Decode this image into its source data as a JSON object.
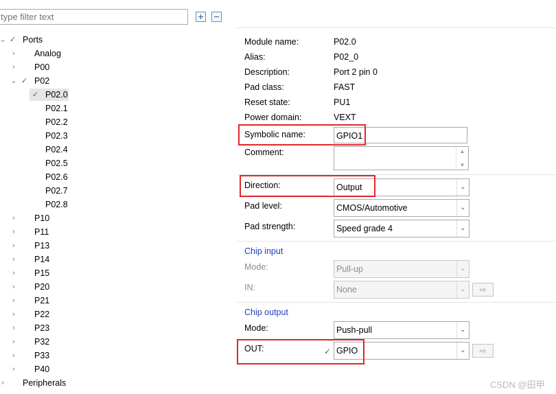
{
  "filter": {
    "placeholder": "type filter text"
  },
  "toolbar": {
    "expand_all": "expand-all-icon",
    "collapse_all": "collapse-all-icon"
  },
  "tree": {
    "root": "Ports",
    "items": [
      "Analog",
      "P00",
      "P02",
      "P02.0",
      "P02.1",
      "P02.2",
      "P02.3",
      "P02.4",
      "P02.5",
      "P02.6",
      "P02.7",
      "P02.8",
      "P10",
      "P11",
      "P13",
      "P14",
      "P15",
      "P20",
      "P21",
      "P22",
      "P23",
      "P32",
      "P33",
      "P40"
    ],
    "bottom": "Peripherals"
  },
  "props": {
    "module_name_label": "Module name:",
    "module_name": "P02.0",
    "alias_label": "Alias:",
    "alias": "P02_0",
    "description_label": "Description:",
    "description": "Port 2 pin 0",
    "pad_class_label": "Pad class:",
    "pad_class": "FAST",
    "reset_state_label": "Reset state:",
    "reset_state": "PU1",
    "power_domain_label": "Power domain:",
    "power_domain": "VEXT",
    "symbolic_name_label": "Symbolic name:",
    "symbolic_name": "GPIO1",
    "comment_label": "Comment:",
    "comment": "",
    "direction_label": "Direction:",
    "direction": "Output",
    "pad_level_label": "Pad level:",
    "pad_level": "CMOS/Automotive",
    "pad_strength_label": "Pad strength:",
    "pad_strength": "Speed grade 4"
  },
  "chip_input": {
    "title": "Chip input",
    "mode_label": "Mode:",
    "mode": "Pull-up",
    "in_label": "IN:",
    "in": "None"
  },
  "chip_output": {
    "title": "Chip output",
    "mode_label": "Mode:",
    "mode": "Push-pull",
    "out_label": "OUT:",
    "out": "GPIO"
  },
  "watermark": "CSDN @田甲",
  "colors": {
    "highlight": "#e0252b",
    "section": "#1f3fbf",
    "check": "#1e8a2e"
  }
}
